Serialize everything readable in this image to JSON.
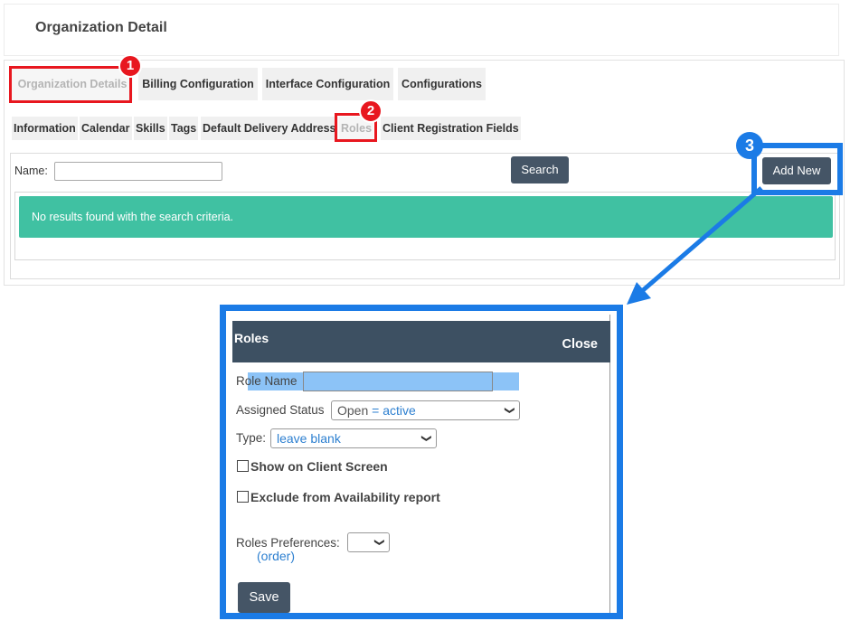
{
  "page": {
    "title": "Organization Detail"
  },
  "main_tabs": [
    "Organization Details",
    "Billing Configuration",
    "Interface Configuration",
    "Configurations"
  ],
  "sub_tabs": [
    "Information",
    "Calendar",
    "Skills",
    "Tags",
    "Default Delivery Address",
    "Roles",
    "Client Registration Fields"
  ],
  "search": {
    "name_label": "Name:",
    "name_value": "",
    "search_button": "Search",
    "add_new_button": "Add New",
    "no_results": "No results found with the search criteria."
  },
  "annotations": {
    "badge1": "1",
    "badge2": "2",
    "badge3": "3"
  },
  "modal": {
    "title": "Roles",
    "close": "Close",
    "role_name_label": "Role Name",
    "role_name_value": "",
    "assigned_status_label": "Assigned Status",
    "assigned_status_value": "Open",
    "assigned_status_note": "= active",
    "type_label": "Type:",
    "type_value": "leave blank",
    "show_on_client": "Show on Client Screen",
    "exclude_availability": "Exclude from Availability report",
    "roles_preferences_label": "Roles Preferences:",
    "roles_preferences_value": "",
    "roles_preferences_note": "(order)",
    "save_button": "Save"
  },
  "colors": {
    "accent_blue": "#1b7be6",
    "alert_green": "#40c1a2",
    "dark_button": "#455566",
    "annotation_red": "#e8171f",
    "modal_header": "#3d5062"
  },
  "icons": {
    "select_chevron": "chevron-down-icon",
    "arrow": "arrow-icon"
  }
}
